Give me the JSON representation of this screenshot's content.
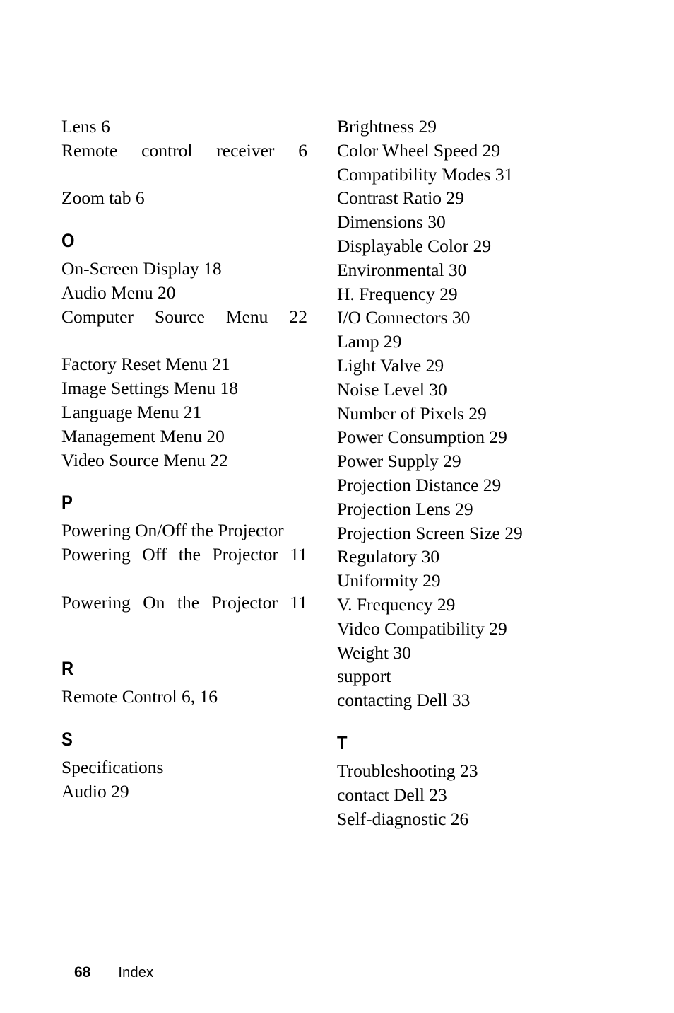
{
  "page": {
    "footer_page_number": "68",
    "footer_separator": "|",
    "footer_label": "Index"
  },
  "columns": {
    "left": {
      "blocks": [
        {
          "letter": null,
          "entries": [
            {
              "level": 2,
              "text": "Lens 6",
              "wrapped": false
            },
            {
              "level": 2,
              "text": "Remote control receiver 6",
              "wrapped": true
            },
            {
              "level": 2,
              "text": "Zoom tab 6",
              "wrapped": false
            }
          ]
        },
        {
          "letter": "O",
          "entries": [
            {
              "level": 1,
              "text": "On-Screen Display 18",
              "wrapped": false
            },
            {
              "level": 2,
              "text": "Audio Menu 20",
              "wrapped": false
            },
            {
              "level": 2,
              "text": "Computer Source Menu 22",
              "wrapped": true
            },
            {
              "level": 2,
              "text": "Factory Reset Menu 21",
              "wrapped": false
            },
            {
              "level": 2,
              "text": "Image Settings Menu 18",
              "wrapped": false
            },
            {
              "level": 2,
              "text": "Language Menu 21",
              "wrapped": false
            },
            {
              "level": 2,
              "text": "Management Menu 20",
              "wrapped": false
            },
            {
              "level": 2,
              "text": "Video Source Menu 22",
              "wrapped": false
            }
          ]
        },
        {
          "letter": "P",
          "entries": [
            {
              "level": 1,
              "text": "Powering On/Off the Projec­tor",
              "wrapped": false
            },
            {
              "level": 2,
              "text": "Powering Off the Projec­tor 11",
              "wrapped": true
            },
            {
              "level": 2,
              "text": "Powering On the Projec­tor 11",
              "wrapped": true
            }
          ]
        },
        {
          "letter": "R",
          "entries": [
            {
              "level": 1,
              "text": "Remote Control 6, 16",
              "wrapped": false
            }
          ]
        },
        {
          "letter": "S",
          "entries": [
            {
              "level": 1,
              "text": "Specifications",
              "wrapped": false
            },
            {
              "level": 2,
              "text": "Audio 29",
              "wrapped": false
            }
          ]
        }
      ]
    },
    "right": {
      "blocks": [
        {
          "letter": null,
          "entries": [
            {
              "level": 2,
              "text": "Brightness 29",
              "wrapped": false
            },
            {
              "level": 2,
              "text": "Color Wheel Speed 29",
              "wrapped": false
            },
            {
              "level": 2,
              "text": "Compatibility Modes 31",
              "wrapped": false
            },
            {
              "level": 2,
              "text": "Contrast Ratio 29",
              "wrapped": false
            },
            {
              "level": 2,
              "text": "Dimensions 30",
              "wrapped": false
            },
            {
              "level": 2,
              "text": "Displayable Color 29",
              "wrapped": false
            },
            {
              "level": 2,
              "text": "Environmental 30",
              "wrapped": false
            },
            {
              "level": 2,
              "text": "H. Frequency 29",
              "wrapped": false
            },
            {
              "level": 2,
              "text": "I/O Connectors 30",
              "wrapped": false
            },
            {
              "level": 2,
              "text": "Lamp 29",
              "wrapped": false
            },
            {
              "level": 2,
              "text": "Light Valve 29",
              "wrapped": false
            },
            {
              "level": 2,
              "text": "Noise Level 30",
              "wrapped": false
            },
            {
              "level": 2,
              "text": "Number of Pixels 29",
              "wrapped": false
            },
            {
              "level": 2,
              "text": "Power Consumption 29",
              "wrapped": false
            },
            {
              "level": 2,
              "text": "Power Supply 29",
              "wrapped": false
            },
            {
              "level": 2,
              "text": "Projection Distance 29",
              "wrapped": false
            },
            {
              "level": 2,
              "text": "Projection Lens 29",
              "wrapped": false
            },
            {
              "level": 2,
              "text": "Projection Screen Size 29",
              "wrapped": false
            },
            {
              "level": 2,
              "text": "Regulatory 30",
              "wrapped": false
            },
            {
              "level": 2,
              "text": "Uniformity 29",
              "wrapped": false
            },
            {
              "level": 2,
              "text": "V. Frequency 29",
              "wrapped": false
            },
            {
              "level": 2,
              "text": "Video Compatibility 29",
              "wrapped": false
            },
            {
              "level": 2,
              "text": "Weight 30",
              "wrapped": false
            },
            {
              "level": 1,
              "text": "support",
              "wrapped": false
            },
            {
              "level": 2,
              "text": "contacting Dell 33",
              "wrapped": false
            }
          ]
        },
        {
          "letter": "T",
          "entries": [
            {
              "level": 1,
              "text": "Troubleshooting 23",
              "wrapped": false
            },
            {
              "level": 2,
              "text": "contact Dell 23",
              "wrapped": false
            },
            {
              "level": 2,
              "text": "Self-diagnostic 26",
              "wrapped": false
            }
          ]
        }
      ]
    }
  }
}
